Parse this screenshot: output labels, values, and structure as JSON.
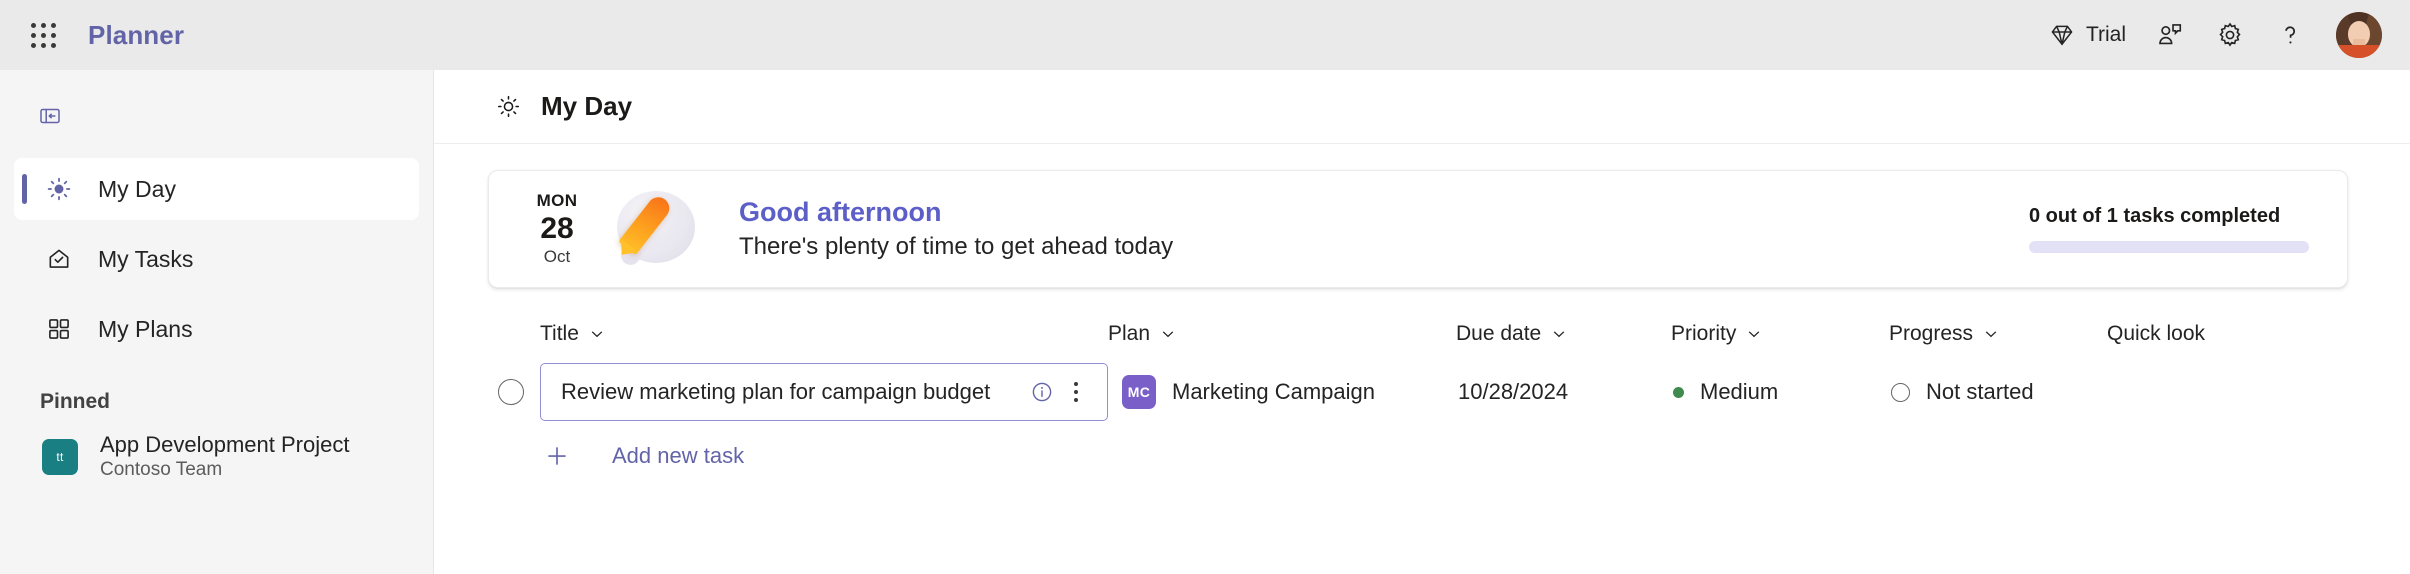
{
  "topbar": {
    "waffle_label": "app-launcher",
    "brand": "Planner",
    "trial_label": "Trial",
    "feedback_label": "feedback",
    "settings_label": "settings",
    "help_label": "help",
    "avatar_label": "account-manager"
  },
  "sidebar": {
    "collapse_label": "collapse-navigation",
    "items": [
      {
        "label": "My Day",
        "icon": "sun-icon",
        "active": true
      },
      {
        "label": "My Tasks",
        "icon": "tasks-home-icon",
        "active": false
      },
      {
        "label": "My Plans",
        "icon": "grid-icon",
        "active": false
      }
    ],
    "pinned_header": "Pinned",
    "pinned": [
      {
        "badge": "tt",
        "name": "App Development Project",
        "sub": "Contoso Team",
        "color": "#1a7f82"
      }
    ]
  },
  "page": {
    "title": "My Day",
    "title_icon": "sun-icon"
  },
  "banner": {
    "date_dow": "MON",
    "date_day": "28",
    "date_month": "Oct",
    "greeting": "Good afternoon",
    "subtitle": "There's plenty of time to get ahead today",
    "progress_label": "0 out of 1 tasks completed",
    "progress_percent": 0,
    "accent": "#5b5fc7",
    "track_color": "#e2e1f5"
  },
  "table": {
    "columns": [
      {
        "label": "Title",
        "sortable": true
      },
      {
        "label": "Plan",
        "sortable": true
      },
      {
        "label": "Due date",
        "sortable": true
      },
      {
        "label": "Priority",
        "sortable": true
      },
      {
        "label": "Progress",
        "sortable": true
      },
      {
        "label": "Quick look",
        "sortable": false
      }
    ],
    "rows": [
      {
        "completed": false,
        "title": "Review marketing plan for campaign budget",
        "plan_badge": "MC",
        "plan_badge_color": "#7b5fc9",
        "plan": "Marketing Campaign",
        "due_date": "10/28/2024",
        "priority": "Medium",
        "priority_color": "#3f8a4e",
        "progress": "Not started",
        "quick_look": ""
      }
    ],
    "add_task_label": "Add new task"
  }
}
